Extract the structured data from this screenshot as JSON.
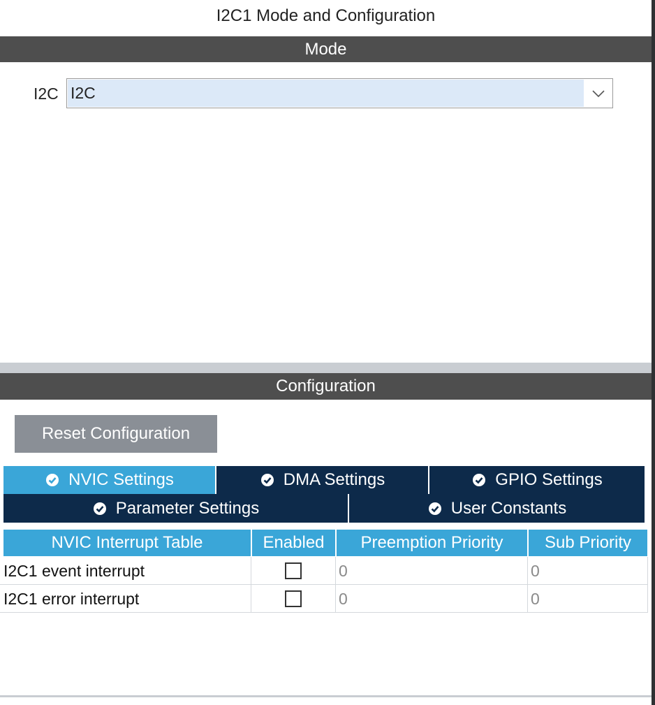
{
  "window": {
    "title": "I2C1 Mode and Configuration"
  },
  "mode": {
    "header": "Mode",
    "i2c_label": "I2C",
    "i2c_value": "I2C"
  },
  "configuration": {
    "header": "Configuration",
    "reset_button": "Reset Configuration",
    "tabs": [
      {
        "label": "NVIC Settings",
        "active": true
      },
      {
        "label": "DMA Settings",
        "active": false
      },
      {
        "label": "GPIO Settings",
        "active": false
      },
      {
        "label": "Parameter Settings",
        "active": false
      },
      {
        "label": "User Constants",
        "active": false
      }
    ]
  },
  "nvic_table": {
    "columns": [
      "NVIC Interrupt Table",
      "Enabled",
      "Preemption Priority",
      "Sub Priority"
    ],
    "rows": [
      {
        "name": "I2C1 event interrupt",
        "enabled": false,
        "preemption": "0",
        "sub": "0"
      },
      {
        "name": "I2C1 error interrupt",
        "enabled": false,
        "preemption": "0",
        "sub": "0"
      }
    ]
  },
  "colors": {
    "header_bg": "#4e4e4e",
    "tab_active": "#3aa6d8",
    "tab_inactive": "#0d2a4a",
    "combo_selection": "#dce9f8",
    "button_disabled": "#8a8f96"
  }
}
